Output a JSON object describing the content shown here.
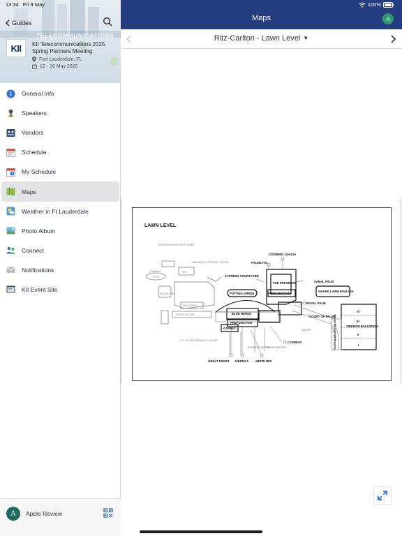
{
  "status_bar": {
    "time": "13:34",
    "date": "Fri 9 May",
    "battery": "100%"
  },
  "sidebar": {
    "back_label": "Guides",
    "header_overlay_text": "TELECOMMUNICATIONS",
    "logo_text": "KII",
    "event_title": "KII Telecommunications 2025 Spring Partners Meeting",
    "location": "Fort Lauderdale, FL",
    "dates": "12 - 16 May 2025",
    "items": [
      {
        "label": "General Info",
        "icon": "info-icon"
      },
      {
        "label": "Speakers",
        "icon": "microphone-icon"
      },
      {
        "label": "Vendors",
        "icon": "vendors-icon"
      },
      {
        "label": "Schedule",
        "icon": "calendar-icon"
      },
      {
        "label": "My Schedule",
        "icon": "my-calendar-icon"
      },
      {
        "label": "Maps",
        "icon": "map-icon",
        "active": true
      },
      {
        "label": "Weather in Ft Lauderdale",
        "icon": "weather-icon"
      },
      {
        "label": "Photo Album",
        "icon": "photo-icon"
      },
      {
        "label": "Connect",
        "icon": "people-icon"
      },
      {
        "label": "Notifications",
        "icon": "envelope-icon"
      },
      {
        "label": "KII Event Site",
        "icon": "website-icon"
      }
    ],
    "footer": {
      "avatar_letter": "A",
      "user_name": "Apple Review"
    }
  },
  "topbar": {
    "title": "Maps",
    "avatar_letter": "A"
  },
  "map_nav": {
    "selected_map": "Ritz-Carlton - Lawn Level"
  },
  "floorplan": {
    "title": "LAWN LEVEL",
    "labels": {
      "reservoir": "THE RESERVOIR EVENT LAWN",
      "massage": "MASSAGE & FITNESS CENTER",
      "cabanas": "CABANAS",
      "pool": "POOL",
      "spa": "SPA",
      "splash": "SPLASH TIKI",
      "kids": "KIDS SPACE",
      "guest_rooms": "GUEST ROOMS",
      "ice": "I.C.E. ENTERTAINMENT LOUNGE",
      "covered_loggia": "COVERED LOGGIA",
      "palmetto": "PALMETTO",
      "cypress_courtyard": "CYPRESS COURTYARD",
      "putting_green": "PUTTING GREEN",
      "the_preserve": "THE PRESERVE",
      "prefunction1": "PREFUNCTION",
      "sabal_palm": "SABAL PALM",
      "grand_lawn": "GRAND LAWN PAVILION",
      "blue_heron": "BLUE HERON",
      "prefunction2": "PREFUNCTION",
      "osprey": "OSPREY",
      "royal_palm": "ROYAL PALM",
      "court_of_palms": "COURT OF PALMS",
      "alcove": "ALCOVE",
      "cypress": "CYPRESS",
      "business_center": "BUSINESS CENTER",
      "computers_atm": "COMPUTERS ATM",
      "great_egret": "GREAT EGRET",
      "anhinga": "ANHINGA",
      "white_ibis": "WHITE IBIS",
      "tiburon_foyer": "TIBURON BALLROOM FOYER",
      "tiburon_ballroom": "TIBURON BALLROOM",
      "ballroom_sections": [
        "IV",
        "III",
        "II",
        "I"
      ]
    }
  },
  "colors": {
    "topbar": "#243d80",
    "active_item_bg": "#e4e4e6",
    "footer_avatar": "#1f6b5a",
    "top_avatar": "#2c9a6f"
  }
}
